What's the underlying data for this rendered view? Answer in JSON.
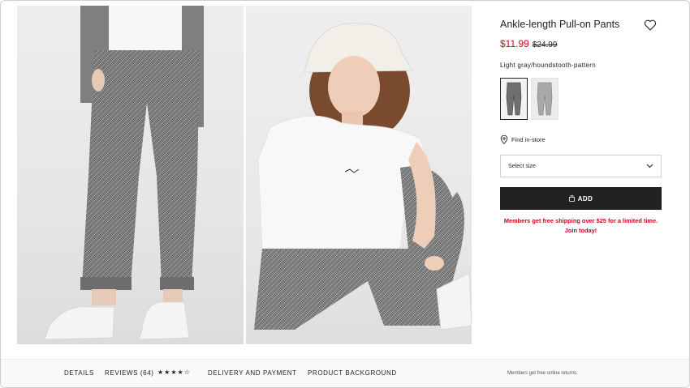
{
  "product": {
    "title": "Ankle-length Pull-on Pants",
    "sale_price": "$11.99",
    "original_price": "$24.99",
    "color_name": "Light gray/houndstooth-pattern",
    "selected_swatch": 1,
    "swatch_count": 2
  },
  "actions": {
    "find_in_store": "Find in-store",
    "size_select_placeholder": "Select size",
    "add_label": "ADD"
  },
  "promo": {
    "line1": "Members get free shipping over $25 for a limited time.",
    "line2": "Join today!"
  },
  "bottom_tabs": {
    "details": "DETAILS",
    "reviews": "REVIEWS (64)",
    "rating_stars": "★★★★☆",
    "rating_value": 4.5,
    "delivery": "DELIVERY AND PAYMENT",
    "background": "PRODUCT BACKGROUND",
    "returns_note": "Members get free online returns."
  },
  "icons": {
    "favorite": "heart-icon",
    "location": "map-pin-icon",
    "dropdown": "chevron-down-icon",
    "bag": "shopping-bag-icon"
  },
  "colors": {
    "sale_red": "#d0021b",
    "button_black": "#222222",
    "bottom_bar_bg": "#faf9f8"
  }
}
